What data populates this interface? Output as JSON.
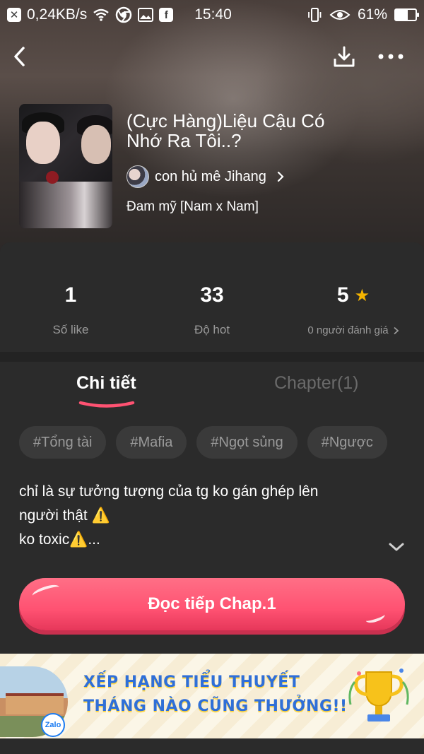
{
  "status_bar": {
    "close_glyph": "✕",
    "network_speed": "0,24KB/s",
    "facebook_glyph": "f",
    "time": "15:40",
    "battery": "61%",
    "battery_level": 0.61
  },
  "book": {
    "title": "(Cực Hàng)Liệu Cậu Có Nhớ Ra Tôi..?",
    "author": "con hủ mê Jihang",
    "genre": "Đam mỹ [Nam x Nam]"
  },
  "stats": {
    "likes_value": "1",
    "likes_label": "Số like",
    "hot_value": "33",
    "hot_label": "Độ hot",
    "rating_value": "5",
    "rating_label": "0 người đánh giá"
  },
  "tabs": {
    "detail": "Chi tiết",
    "chapter": "Chapter(1)"
  },
  "tags": [
    "#Tổng tài",
    "#Mafia",
    "#Ngọt sủng",
    "#Ngược"
  ],
  "description": {
    "line1": "chỉ là sự tưởng tượng của tg ko gán ghép lên",
    "line2": "người thật ⚠️",
    "line3": "ko toxic⚠️..."
  },
  "cta": {
    "label": "Đọc tiếp Chap.1"
  },
  "banner": {
    "line1": "XẾP HẠNG TIỂU THUYẾT",
    "line2": "THÁNG NÀO CŨNG THƯỞNG!!",
    "badge": "Zalo"
  },
  "colors": {
    "accent": "#ff5272",
    "background": "#2b2b2b",
    "star": "#f4b400",
    "banner_text": "#2f6fd8"
  }
}
